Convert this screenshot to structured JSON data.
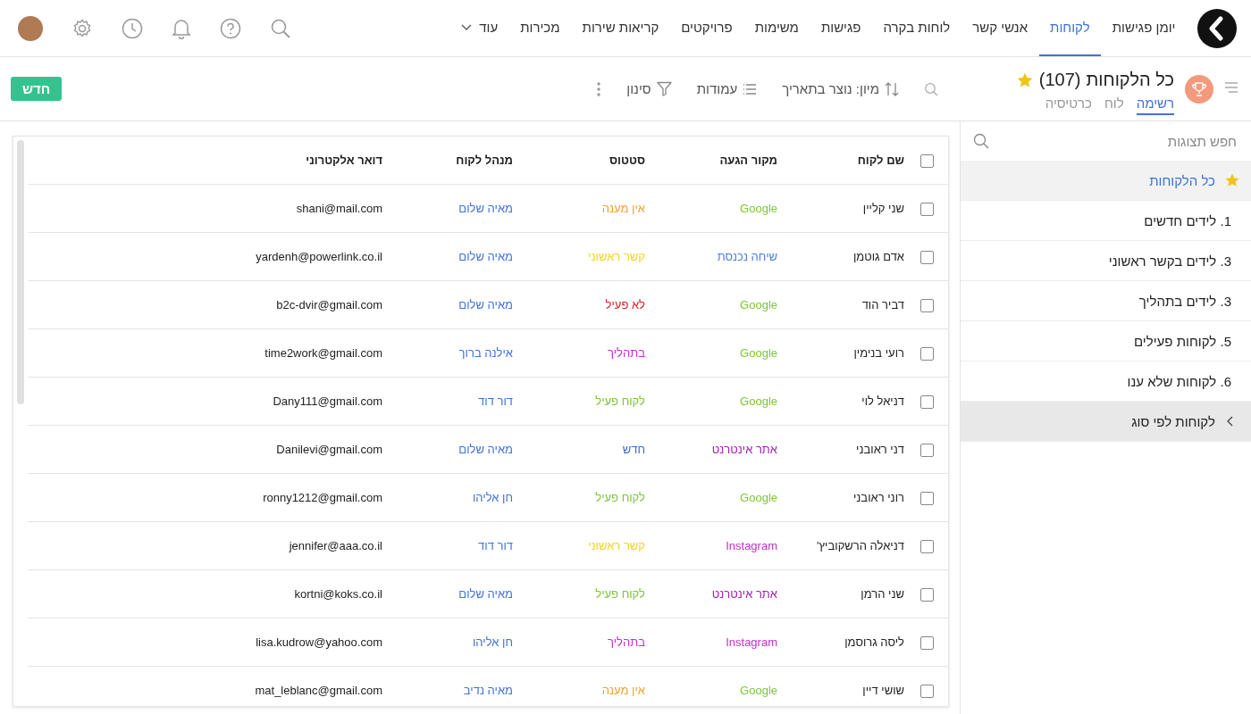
{
  "nav": {
    "items": [
      {
        "label": "יומן פגישות",
        "selected": false
      },
      {
        "label": "לקוחות",
        "selected": true
      },
      {
        "label": "אנשי קשר",
        "selected": false
      },
      {
        "label": "לוחות בקרה",
        "selected": false
      },
      {
        "label": "פגישות",
        "selected": false
      },
      {
        "label": "משימות",
        "selected": false
      },
      {
        "label": "פרויקטים",
        "selected": false
      },
      {
        "label": "קריאות שירות",
        "selected": false
      },
      {
        "label": "מכירות",
        "selected": false
      }
    ],
    "more": "עוד"
  },
  "header": {
    "title": "כל הלקוחות",
    "count": "(107)",
    "views": [
      {
        "label": "רשימה",
        "selected": true
      },
      {
        "label": "לוח",
        "selected": false
      },
      {
        "label": "כרטיסיה",
        "selected": false
      }
    ]
  },
  "toolbar": {
    "sort": "מיון: נוצר בתאריך",
    "columns": "עמודות",
    "filter": "סינון",
    "new_button": "חדש"
  },
  "sidebar": {
    "search": {
      "placeholder": "חפש תצוגות"
    },
    "items": [
      {
        "kind": "view",
        "label": "כל הלקוחות",
        "selected": true,
        "favorite": true
      },
      {
        "kind": "view",
        "label": "1. לידים חדשים",
        "selected": false,
        "favorite": false
      },
      {
        "kind": "view",
        "label": "3. לידים בקשר ראשוני",
        "selected": false,
        "favorite": false
      },
      {
        "kind": "view",
        "label": "3. לידים בתהליך",
        "selected": false,
        "favorite": false
      },
      {
        "kind": "view",
        "label": "5. לקוחות פעילים",
        "selected": false,
        "favorite": false
      },
      {
        "kind": "view",
        "label": "6. לקוחות שלא ענו",
        "selected": false,
        "favorite": false
      },
      {
        "kind": "group",
        "label": "לקוחות לפי סוג",
        "selected": false,
        "expanded": false
      }
    ]
  },
  "table": {
    "select_all": {
      "checked": false
    },
    "columns": [
      "שם לקוח",
      "מקור הגעה",
      "סטטוס",
      "מנהל לקוח",
      "דואר אלקטרוני"
    ],
    "rows": [
      {
        "checked": false,
        "name": "שני קליין",
        "source": {
          "text": "Google",
          "color": "#7cc43a"
        },
        "status": {
          "text": "אין מענה",
          "color": "#f0a030"
        },
        "manager": "מאיה שלום",
        "email": "shani@mail.com"
      },
      {
        "checked": false,
        "name": "אדם גוטמן",
        "source": {
          "text": "שיחה נכנסת",
          "color": "#4a7fd6"
        },
        "status": {
          "text": "קשר ראשוני",
          "color": "#f5d320"
        },
        "manager": "מאיה שלום",
        "email": "yardenh@powerlink.co.il"
      },
      {
        "checked": false,
        "name": "דביר הוד",
        "source": {
          "text": "Google",
          "color": "#7cc43a"
        },
        "status": {
          "text": "לא פעיל",
          "color": "#d42020"
        },
        "manager": "מאיה שלום",
        "email": "b2c-dvir@gmail.com"
      },
      {
        "checked": false,
        "name": "רועי בנימין",
        "source": {
          "text": "Google",
          "color": "#7cc43a"
        },
        "status": {
          "text": "בתהליך",
          "color": "#c030c8"
        },
        "manager": "אילנה ברוך",
        "email": "time2work@gmail.com"
      },
      {
        "checked": false,
        "name": "דניאל לוי",
        "source": {
          "text": "Google",
          "color": "#7cc43a"
        },
        "status": {
          "text": "לקוח פעיל",
          "color": "#7cc43a"
        },
        "manager": "דור דוד",
        "email": "Dany111@gmail.com"
      },
      {
        "checked": false,
        "name": "דני ראובני",
        "source": {
          "text": "אתר אינטרנט",
          "color": "#a020b0"
        },
        "status": {
          "text": "חדש",
          "color": "#3a6ac8"
        },
        "manager": "מאיה שלום",
        "email": "Danilevi@gmail.com"
      },
      {
        "checked": false,
        "name": "רוני ראובני",
        "source": {
          "text": "Google",
          "color": "#7cc43a"
        },
        "status": {
          "text": "לקוח פעיל",
          "color": "#7cc43a"
        },
        "manager": "חן אליהו",
        "email": "ronny1212@gmail.com"
      },
      {
        "checked": false,
        "name": "דניאלה הרשקוביץ'",
        "source": {
          "text": "Instagram",
          "color": "#c030c8"
        },
        "status": {
          "text": "קשר ראשוני",
          "color": "#f5d320"
        },
        "manager": "דור דוד",
        "email": "jennifer@aaa.co.il"
      },
      {
        "checked": false,
        "name": "שני הרמן",
        "source": {
          "text": "אתר אינטרנט",
          "color": "#a020b0"
        },
        "status": {
          "text": "לקוח פעיל",
          "color": "#7cc43a"
        },
        "manager": "מאיה שלום",
        "email": "kortni@koks.co.il"
      },
      {
        "checked": false,
        "name": "ליסה גרוסמן",
        "source": {
          "text": "Instagram",
          "color": "#c030c8"
        },
        "status": {
          "text": "בתהליך",
          "color": "#c030c8"
        },
        "manager": "חן אליהו",
        "email": "lisa.kudrow@yahoo.com"
      },
      {
        "checked": false,
        "name": "שושי דיין",
        "source": {
          "text": "Google",
          "color": "#7cc43a"
        },
        "status": {
          "text": "אין מענה",
          "color": "#f0a030"
        },
        "manager": "מאיה נדיב",
        "email": "mat_leblanc@gmail.com"
      }
    ]
  }
}
